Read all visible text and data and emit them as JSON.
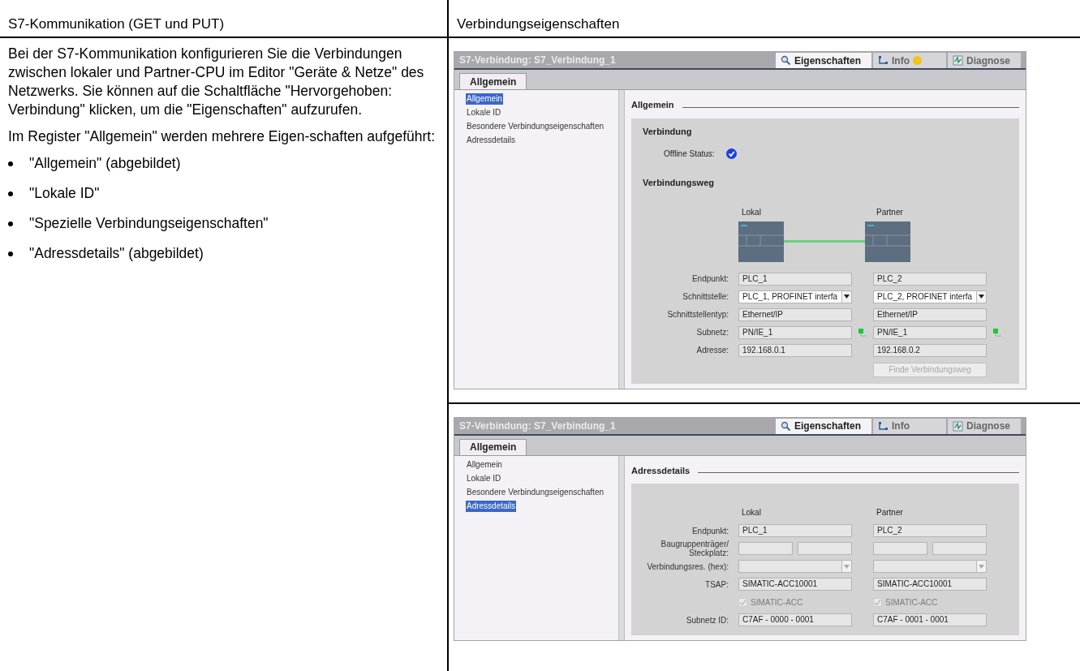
{
  "table": {
    "columns": [
      "S7-Kommunikation (GET und PUT)",
      "Verbindungseigenschaften"
    ]
  },
  "description": {
    "paragraphs": [
      "Bei der S7-Kommunikation konfigurieren Sie die Verbindungen zwischen lokaler und Partner-CPU im Editor \"Geräte & Netze\" des Netzwerks. Sie können auf die Schaltfläche \"Hervorgehoben: Verbindung\" klicken, um die \"Eigenschaften\" aufzurufen.",
      "Im Register \"Allgemein\" werden mehrere Eigen-schaften aufgeführt:"
    ],
    "bullets": [
      "\"Allgemein\" (abgebildet)",
      "\"Lokale ID\"",
      "\"Spezielle Verbindungseigenschaften\"",
      "\"Adressdetails\" (abgebildet)"
    ]
  },
  "panels": [
    {
      "kind": "general",
      "title": "S7-Verbindung: S7_Verbindung_1",
      "tabs": [
        {
          "label": "Eigenschaften",
          "selected": true,
          "warning": false
        },
        {
          "label": "Info",
          "selected": false,
          "warning": true
        },
        {
          "label": "Diagnose",
          "selected": false,
          "warning": false
        }
      ],
      "section_tab": "Allgemein",
      "nav": [
        {
          "label": "Allgemein",
          "selected": true
        },
        {
          "label": "Lokale ID",
          "selected": false
        },
        {
          "label": "Besondere Verbindungseigenschaften",
          "selected": false
        },
        {
          "label": "Adressdetails",
          "selected": false
        }
      ],
      "heading": "Allgemein",
      "group": "Verbindung",
      "status_label": "Offline Status:",
      "status_ok": true,
      "path_heading": "Verbindungsweg",
      "columns": [
        "Lokal",
        "Partner"
      ],
      "rows": [
        {
          "kind": "text",
          "label": "Endpunkt:",
          "values": [
            "PLC_1",
            "PLC_2"
          ]
        },
        {
          "kind": "select",
          "label": "Schnittstelle:",
          "values": [
            "PLC_1, PROFINET interfa",
            "PLC_2, PROFINET interfa"
          ]
        },
        {
          "kind": "text",
          "label": "Schnittstellentyp:",
          "values": [
            "Ethernet/IP",
            "Ethernet/IP"
          ]
        },
        {
          "kind": "text",
          "label": "Subnetz:",
          "values": [
            "PN/IE_1",
            "PN/IE_1"
          ],
          "network": true
        },
        {
          "kind": "text",
          "label": "Adresse:",
          "values": [
            "192.168.0.1",
            "192.168.0.2"
          ]
        }
      ],
      "button": {
        "label": "Finde Verbindungsweg",
        "disabled": true
      }
    },
    {
      "kind": "address",
      "title": "S7-Verbindung: S7_Verbindung_1",
      "tabs": [
        {
          "label": "Eigenschaften",
          "selected": true,
          "warning": false
        },
        {
          "label": "Info",
          "selected": false,
          "warning": false
        },
        {
          "label": "Diagnose",
          "selected": false,
          "warning": false
        }
      ],
      "section_tab": "Allgemein",
      "nav": [
        {
          "label": "Allgemein",
          "selected": false
        },
        {
          "label": "Lokale ID",
          "selected": false
        },
        {
          "label": "Besondere Verbindungseigenschaften",
          "selected": false
        },
        {
          "label": "Adressdetails",
          "selected": true
        }
      ],
      "heading": "Adressdetails",
      "columns": [
        "Lokal",
        "Partner"
      ],
      "rows": [
        {
          "kind": "text",
          "label": "Endpunkt:",
          "values": [
            "PLC_1",
            "PLC_2"
          ]
        },
        {
          "kind": "split",
          "label": "Baugruppenträger/ Steckplatz:"
        },
        {
          "kind": "empty_select",
          "label": "Verbindungsres. (hex):"
        },
        {
          "kind": "text",
          "label": "TSAP:",
          "values": [
            "SIMATIC-ACC10001",
            "SIMATIC-ACC10001"
          ]
        },
        {
          "kind": "checkbox",
          "values": [
            "SIMATIC-ACC",
            "SIMATIC-ACC"
          ],
          "checked": true,
          "disabled": true
        },
        {
          "kind": "text",
          "label": "Subnetz ID:",
          "values": [
            "C7AF - 0000 - 0001",
            "C7AF - 0001 - 0001"
          ]
        }
      ]
    }
  ]
}
